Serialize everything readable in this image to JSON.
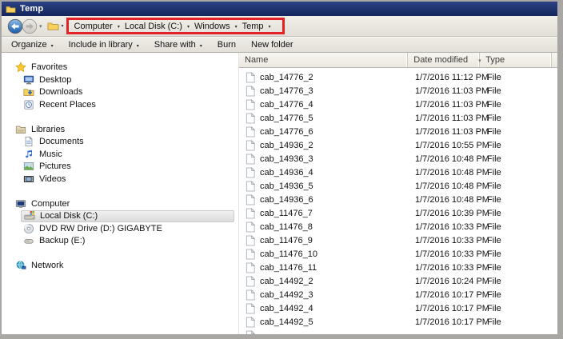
{
  "window": {
    "title": "Temp",
    "icon": "folder-icon"
  },
  "nav": {
    "back_icon": "back-icon",
    "forward_icon": "forward-icon",
    "recent_pages_icon": "chevron-down-icon",
    "address_icon": "folder-icon",
    "breadcrumb": {
      "segments": [
        "Computer",
        "Local Disk (C:)",
        "Windows",
        "Temp"
      ],
      "highlight_color": "#e32227"
    }
  },
  "toolbar": {
    "items": [
      {
        "label": "Organize",
        "has_dropdown": true
      },
      {
        "label": "Include in library",
        "has_dropdown": true
      },
      {
        "label": "Share with",
        "has_dropdown": true
      },
      {
        "label": "Burn",
        "has_dropdown": false
      },
      {
        "label": "New folder",
        "has_dropdown": false
      }
    ]
  },
  "sidebar": {
    "sections": [
      {
        "label": "Favorites",
        "icon": "star-icon",
        "items": [
          {
            "label": "Desktop",
            "icon": "desktop-icon"
          },
          {
            "label": "Downloads",
            "icon": "downloads-icon"
          },
          {
            "label": "Recent Places",
            "icon": "recent-places-icon"
          }
        ]
      },
      {
        "label": "Libraries",
        "icon": "libraries-icon",
        "items": [
          {
            "label": "Documents",
            "icon": "documents-icon"
          },
          {
            "label": "Music",
            "icon": "music-icon"
          },
          {
            "label": "Pictures",
            "icon": "pictures-icon"
          },
          {
            "label": "Videos",
            "icon": "videos-icon"
          }
        ]
      },
      {
        "label": "Computer",
        "icon": "computer-icon",
        "items": [
          {
            "label": "Local Disk (C:)",
            "icon": "local-disk-icon",
            "selected": true
          },
          {
            "label": "DVD RW Drive (D:) GIGABYTE",
            "icon": "dvd-drive-icon"
          },
          {
            "label": "Backup (E:)",
            "icon": "backup-drive-icon"
          }
        ]
      },
      {
        "label": "Network",
        "icon": "network-icon",
        "items": []
      }
    ]
  },
  "file_list": {
    "columns": [
      "Name",
      "Date modified",
      "Type"
    ],
    "sort": {
      "column": "Date modified",
      "direction": "descending"
    },
    "row_icon": "file-icon",
    "rows": [
      {
        "name": "cab_14776_2",
        "date_modified": "1/7/2016 11:12 PM",
        "type": "File"
      },
      {
        "name": "cab_14776_3",
        "date_modified": "1/7/2016 11:03 PM",
        "type": "File"
      },
      {
        "name": "cab_14776_4",
        "date_modified": "1/7/2016 11:03 PM",
        "type": "File"
      },
      {
        "name": "cab_14776_5",
        "date_modified": "1/7/2016 11:03 PM",
        "type": "File"
      },
      {
        "name": "cab_14776_6",
        "date_modified": "1/7/2016 11:03 PM",
        "type": "File"
      },
      {
        "name": "cab_14936_2",
        "date_modified": "1/7/2016 10:55 PM",
        "type": "File"
      },
      {
        "name": "cab_14936_3",
        "date_modified": "1/7/2016 10:48 PM",
        "type": "File"
      },
      {
        "name": "cab_14936_4",
        "date_modified": "1/7/2016 10:48 PM",
        "type": "File"
      },
      {
        "name": "cab_14936_5",
        "date_modified": "1/7/2016 10:48 PM",
        "type": "File"
      },
      {
        "name": "cab_14936_6",
        "date_modified": "1/7/2016 10:48 PM",
        "type": "File"
      },
      {
        "name": "cab_11476_7",
        "date_modified": "1/7/2016 10:39 PM",
        "type": "File"
      },
      {
        "name": "cab_11476_8",
        "date_modified": "1/7/2016 10:33 PM",
        "type": "File"
      },
      {
        "name": "cab_11476_9",
        "date_modified": "1/7/2016 10:33 PM",
        "type": "File"
      },
      {
        "name": "cab_11476_10",
        "date_modified": "1/7/2016 10:33 PM",
        "type": "File"
      },
      {
        "name": "cab_11476_11",
        "date_modified": "1/7/2016 10:33 PM",
        "type": "File"
      },
      {
        "name": "cab_14492_2",
        "date_modified": "1/7/2016 10:24 PM",
        "type": "File"
      },
      {
        "name": "cab_14492_3",
        "date_modified": "1/7/2016 10:17 PM",
        "type": "File"
      },
      {
        "name": "cab_14492_4",
        "date_modified": "1/7/2016 10:17 PM",
        "type": "File"
      },
      {
        "name": "cab_14492_5",
        "date_modified": "1/7/2016 10:17 PM",
        "type": "File"
      }
    ]
  },
  "colors": {
    "title_bar": "#1d2f66",
    "chrome_gray": "#e7e4dd",
    "highlight_box": "#e32227",
    "selected_item_bg": "#e4e4e4",
    "window_border": "#a8a7a3"
  }
}
